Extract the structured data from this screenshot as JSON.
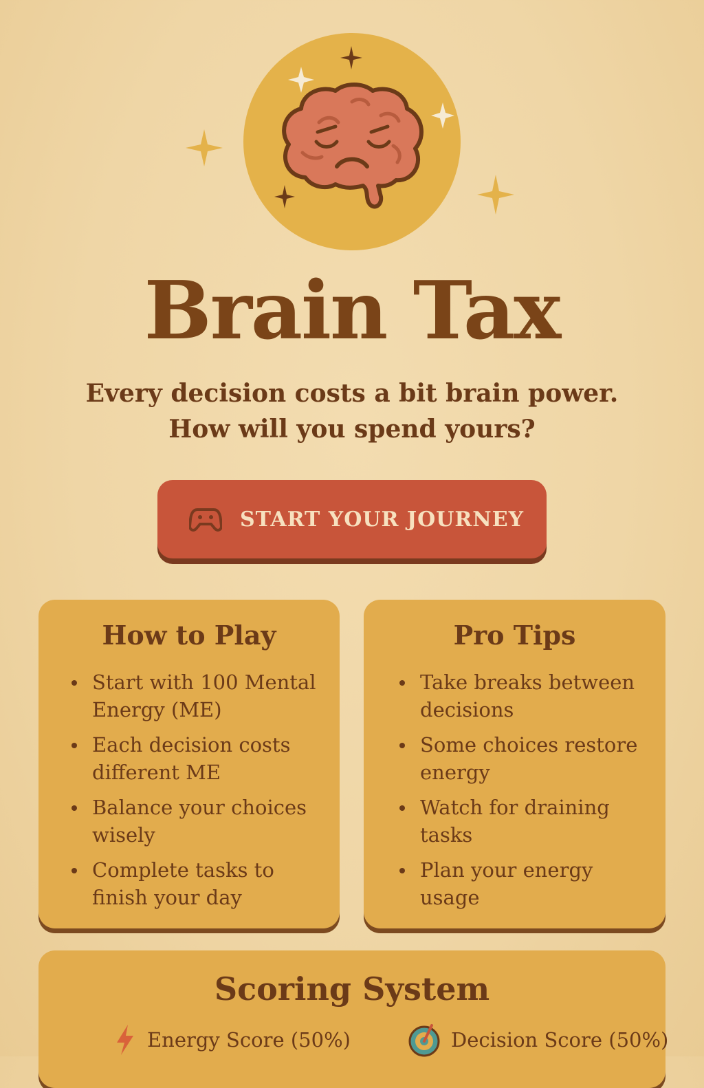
{
  "app": {
    "title": "Brain Tax",
    "subtitle_line1": "Every decision costs a bit brain power.",
    "subtitle_line2": "How will you spend yours?"
  },
  "hero": {
    "icon": "sad-brain-icon",
    "sparkles": [
      "sparkle-icon"
    ]
  },
  "start_button": {
    "label": "START YOUR JOURNEY",
    "icon": "gamepad-icon"
  },
  "how_to_play": {
    "title": "How to Play",
    "items": [
      "Start with 100 Mental Energy (ME)",
      "Each decision costs different ME",
      "Balance your choices wisely",
      "Complete tasks to finish your day"
    ]
  },
  "pro_tips": {
    "title": "Pro Tips",
    "items": [
      "Take breaks between decisions",
      "Some choices restore energy",
      "Watch for draining tasks",
      "Plan your energy usage"
    ]
  },
  "scoring": {
    "title": "Scoring System",
    "items": [
      {
        "label": "Energy Score (50%)",
        "icon": "lightning-icon"
      },
      {
        "label": "Decision Score (50%)",
        "icon": "target-icon"
      }
    ]
  },
  "colors": {
    "background": "#efd6a6",
    "hero_circle": "#e4b24a",
    "brain": "#d9785a",
    "accent_button": "#c8553a",
    "card": "#e2ac4d",
    "text": "#6b3a18"
  }
}
